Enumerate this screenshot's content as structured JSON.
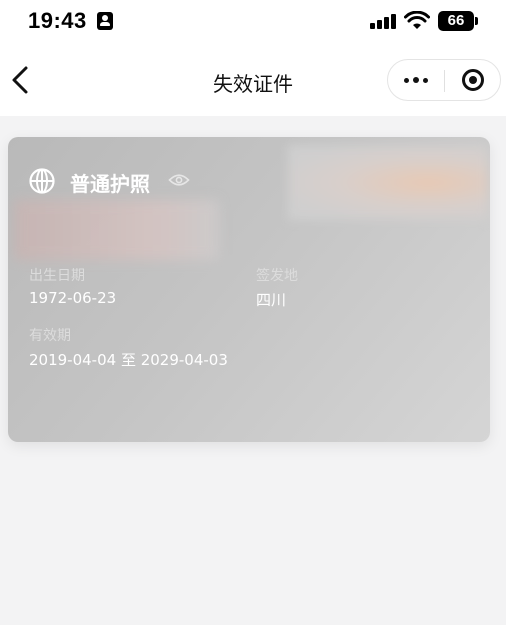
{
  "status_bar": {
    "time": "19:43",
    "battery": "66"
  },
  "nav": {
    "title": "失效证件"
  },
  "card": {
    "doc_type": "普通护照",
    "birth_date_label": "出生日期",
    "birth_date": "1972-06-23",
    "issue_place_label": "签发地",
    "issue_place": "四川",
    "validity_label": "有效期",
    "validity": "2019-04-04 至 2029-04-03"
  },
  "colors": {
    "card_bg": "#c4c4c4",
    "page_bg": "#f3f3f4",
    "nav_bg": "#ffffff"
  }
}
